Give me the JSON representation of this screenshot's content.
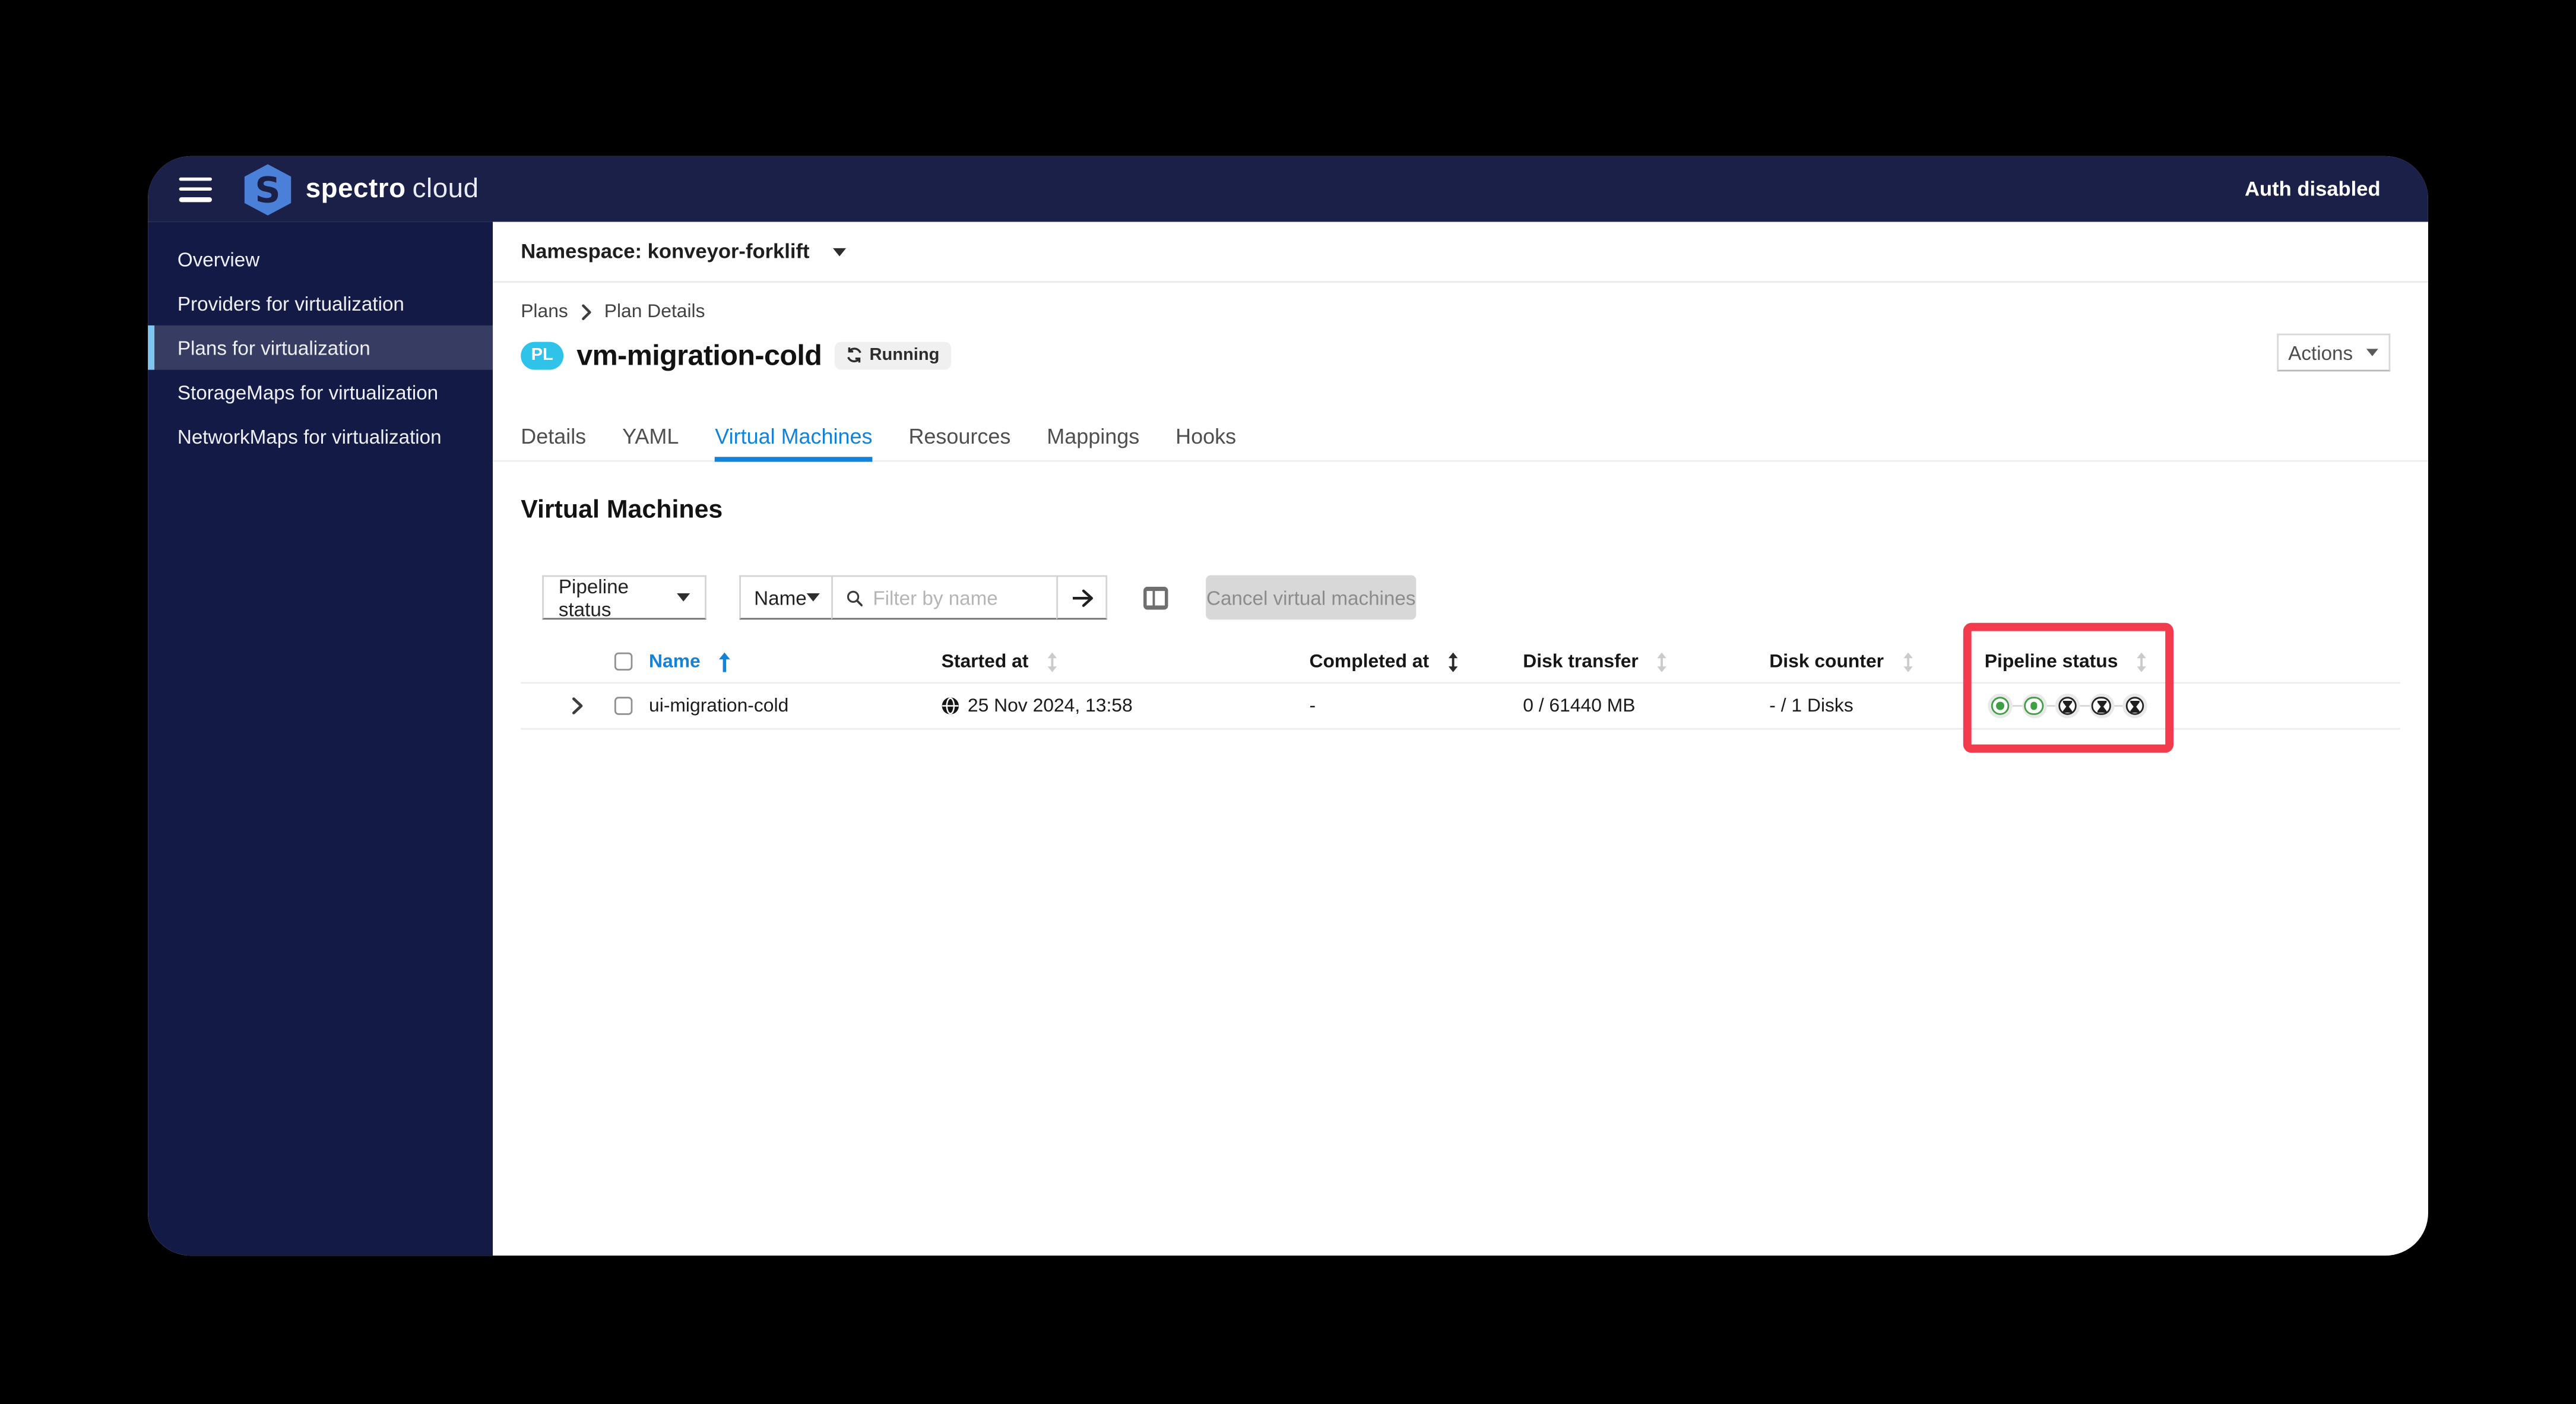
{
  "header": {
    "brand_primary": "spectro",
    "brand_secondary": "cloud",
    "auth_status": "Auth disabled"
  },
  "sidebar": {
    "items": [
      {
        "label": "Overview",
        "active": false
      },
      {
        "label": "Providers for virtualization",
        "active": false
      },
      {
        "label": "Plans for virtualization",
        "active": true
      },
      {
        "label": "StorageMaps for virtualization",
        "active": false
      },
      {
        "label": "NetworkMaps for virtualization",
        "active": false
      }
    ]
  },
  "namespace_bar": {
    "label": "Namespace: konveyor-forklift"
  },
  "breadcrumb": {
    "items": [
      "Plans",
      "Plan Details"
    ]
  },
  "plan_header": {
    "kind_badge": "PL",
    "title": "vm-migration-cold",
    "status_label": "Running",
    "actions_button": "Actions"
  },
  "tabs": [
    {
      "label": "Details",
      "active": false
    },
    {
      "label": "YAML",
      "active": false
    },
    {
      "label": "Virtual Machines",
      "active": true
    },
    {
      "label": "Resources",
      "active": false
    },
    {
      "label": "Mappings",
      "active": false
    },
    {
      "label": "Hooks",
      "active": false
    }
  ],
  "section_title": "Virtual Machines",
  "toolbar": {
    "pipeline_status_dropdown": "Pipeline status",
    "name_dropdown": "Name",
    "search_placeholder": "Filter by name",
    "cancel_button": "Cancel virtual machines"
  },
  "table": {
    "columns": [
      {
        "label": "Name",
        "sort": "ascending-active"
      },
      {
        "label": "Started at",
        "sort": "sortable"
      },
      {
        "label": "Completed at",
        "sort": "sortable-emphasized"
      },
      {
        "label": "Disk transfer",
        "sort": "sortable"
      },
      {
        "label": "Disk counter",
        "sort": "sortable"
      },
      {
        "label": "Pipeline status",
        "sort": "sortable"
      }
    ],
    "rows": [
      {
        "name": "ui-migration-cold",
        "started_at": "25 Nov 2024, 13:58",
        "completed_at": "-",
        "disk_transfer": "0 / 61440 MB",
        "disk_counter": "- / 1 Disks",
        "pipeline": {
          "steps": [
            "completed",
            "completed",
            "pending",
            "pending",
            "pending"
          ]
        }
      }
    ]
  },
  "annotation": {
    "highlight_target": "Pipeline status column",
    "color": "#f23b4c"
  },
  "colors": {
    "header_navy": "#1a2048",
    "sidebar_navy": "#141a46",
    "sidebar_active": "#373d62",
    "sidebar_accent": "#80c5ef",
    "kind_badge_cyan": "#2fc3e9",
    "active_tab_blue": "#1482d6",
    "pipeline_done_green": "#3f9e43",
    "annotation_red": "#f23b4c",
    "disabled_button": "#d8d8d8"
  }
}
